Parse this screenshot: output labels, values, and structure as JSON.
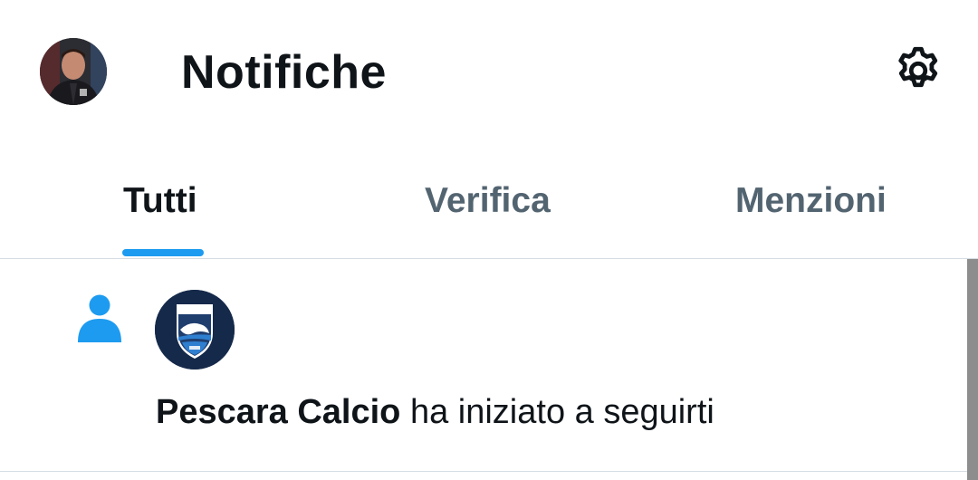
{
  "header": {
    "title": "Notifiche",
    "avatar_icon": "user-avatar",
    "settings_icon": "gear-icon"
  },
  "tabs": [
    {
      "label": "Tutti",
      "active": true
    },
    {
      "label": "Verifica",
      "active": false
    },
    {
      "label": "Menzioni",
      "active": false
    }
  ],
  "notifications": [
    {
      "type_icon": "person-icon",
      "account_logo": "pescara-calcio-logo",
      "account_name": "Pescara Calcio",
      "message": " ha iniziato a seguirti"
    }
  ],
  "colors": {
    "accent": "#1d9bf0",
    "text_primary": "#0f1419",
    "text_secondary": "#536471",
    "divider": "#d6dde3"
  }
}
